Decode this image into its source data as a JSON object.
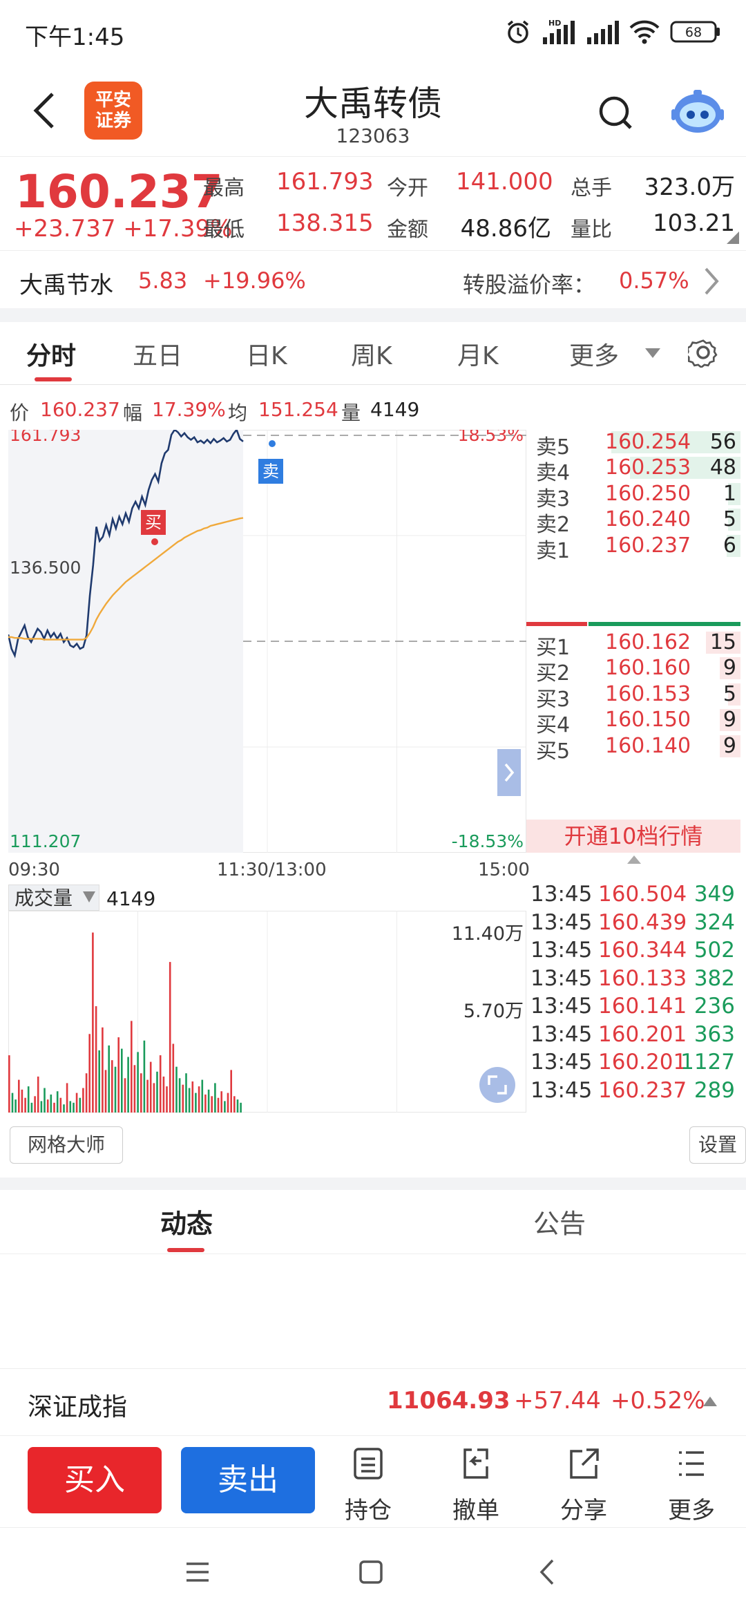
{
  "status": {
    "time": "下午1:45",
    "battery": "68",
    "network": "HD"
  },
  "header": {
    "title": "大禹转债",
    "code": "123063",
    "logo": "平安\n证券",
    "logo_line1": "平安",
    "logo_line2": "证券"
  },
  "quote": {
    "price": "160.237",
    "change": "+23.737",
    "change_pct": "+17.39%",
    "high_label": "最高",
    "high": "161.793",
    "low_label": "最低",
    "low": "138.315",
    "open_label": "今开",
    "open": "141.000",
    "amount_label": "金额",
    "amount": "48.86亿",
    "volume_label": "总手",
    "volume": "323.0万",
    "ratio_label": "量比",
    "ratio": "103.21"
  },
  "underlying": {
    "name": "大禹节水",
    "price": "5.83",
    "change_pct": "+19.96%",
    "premium_label": "转股溢价率：",
    "premium": "0.57%"
  },
  "tabs": [
    "分时",
    "五日",
    "日K",
    "周K",
    "月K",
    "更多"
  ],
  "active_tab": "分时",
  "infobar": {
    "price_label": "价",
    "price": "160.237",
    "amp_label": "幅",
    "amp": "17.39%",
    "avg_label": "均",
    "avg": "151.254",
    "vol_label": "量",
    "vol": "4149"
  },
  "chart_labels": {
    "top_left": "161.793",
    "top_right": "18.53%",
    "mid_left": "136.500",
    "bottom_left": "111.207",
    "bottom_right": "-18.53%",
    "buy_marker": "买",
    "sell_marker": "卖"
  },
  "orderbook": {
    "asks": [
      {
        "label": "卖5",
        "price": "160.254",
        "vol": "56"
      },
      {
        "label": "卖4",
        "price": "160.253",
        "vol": "48"
      },
      {
        "label": "卖3",
        "price": "160.250",
        "vol": "1"
      },
      {
        "label": "卖2",
        "price": "160.240",
        "vol": "5"
      },
      {
        "label": "卖1",
        "price": "160.237",
        "vol": "6"
      }
    ],
    "bids": [
      {
        "label": "买1",
        "price": "160.162",
        "vol": "15"
      },
      {
        "label": "买2",
        "price": "160.160",
        "vol": "9"
      },
      {
        "label": "买3",
        "price": "160.153",
        "vol": "5"
      },
      {
        "label": "买4",
        "price": "160.150",
        "vol": "9"
      },
      {
        "label": "买5",
        "price": "160.140",
        "vol": "9"
      }
    ],
    "upgrade": "开通10档行情"
  },
  "time_axis": [
    "09:30",
    "11:30/13:00",
    "15:00"
  ],
  "volume_panel": {
    "selector": "成交量",
    "value": "4149",
    "max_label": "11.40万",
    "mid_label": "5.70万"
  },
  "ticks": [
    {
      "time": "13:45",
      "price": "160.504",
      "vol": "349"
    },
    {
      "time": "13:45",
      "price": "160.439",
      "vol": "324"
    },
    {
      "time": "13:45",
      "price": "160.344",
      "vol": "502"
    },
    {
      "time": "13:45",
      "price": "160.133",
      "vol": "382"
    },
    {
      "time": "13:45",
      "price": "160.141",
      "vol": "236"
    },
    {
      "time": "13:45",
      "price": "160.201",
      "vol": "363"
    },
    {
      "time": "13:45",
      "price": "160.201",
      "vol": "1127"
    },
    {
      "time": "13:45",
      "price": "160.237",
      "vol": "289"
    }
  ],
  "buttons": {
    "grid": "网格大师",
    "settings": "设置"
  },
  "news_tabs": [
    "动态",
    "公告"
  ],
  "index": {
    "name": "深证成指",
    "value": "11064.93",
    "change": "+57.44",
    "change_pct": "+0.52%"
  },
  "toolbar": {
    "buy": "买入",
    "sell": "卖出",
    "position": "持仓",
    "cancel": "撤单",
    "share": "分享",
    "more": "更多"
  },
  "colors": {
    "up": "#e0393e",
    "down": "#1a9b5b",
    "sell_button": "#1e6fe0",
    "buy_button": "#e8262b",
    "avg_line": "#f0a93b",
    "price_line": "#1f3a6e"
  },
  "chart_data": {
    "type": "line",
    "title": "",
    "xlabel": "",
    "ylabel": "",
    "ylim": [
      111.207,
      161.793
    ],
    "reference": 136.5,
    "x_ticks": [
      "09:30",
      "11:30/13:00",
      "15:00"
    ],
    "series": [
      {
        "name": "价",
        "values": [
          137.3,
          135.6,
          134.8,
          136.8,
          137.6,
          138.4,
          137.0,
          136.4,
          137.2,
          138.0,
          137.6,
          136.8,
          137.8,
          137.0,
          137.5,
          136.8,
          137.4,
          136.4,
          136.9,
          136.0,
          135.8,
          136.2,
          135.6,
          135.8,
          137.2,
          142.0,
          145.6,
          150.2,
          148.5,
          149.0,
          150.4,
          149.2,
          151.1,
          150.0,
          151.4,
          150.5,
          151.8,
          150.8,
          152.4,
          153.2,
          152.4,
          153.8,
          152.8,
          154.6,
          155.8,
          156.5,
          155.6,
          157.8,
          159.0,
          159.4,
          161.2,
          161.8,
          161.5,
          161.0,
          161.4,
          160.9,
          160.6,
          160.9,
          160.3,
          160.5,
          160.2,
          160.6,
          160.2,
          160.7,
          160.3,
          160.5,
          160.8,
          160.4,
          160.6,
          161.3,
          161.8,
          160.7,
          160.4
        ]
      },
      {
        "name": "均",
        "values": [
          137.0,
          137.0,
          136.9,
          136.9,
          136.9,
          136.8,
          136.8,
          136.8,
          136.8,
          136.8,
          136.8,
          136.7,
          136.7,
          136.7,
          136.7,
          136.7,
          136.7,
          136.7,
          136.7,
          136.7,
          136.7,
          136.7,
          136.7,
          136.7,
          136.9,
          137.5,
          138.2,
          139.1,
          139.8,
          140.4,
          141.0,
          141.5,
          142.0,
          142.4,
          142.8,
          143.2,
          143.6,
          143.9,
          144.2,
          144.5,
          144.8,
          145.1,
          145.4,
          145.7,
          146.0,
          146.3,
          146.6,
          146.9,
          147.2,
          147.5,
          147.8,
          148.1,
          148.4,
          148.6,
          148.9,
          149.1,
          149.3,
          149.5,
          149.7,
          149.8,
          150.0,
          150.1,
          150.3,
          150.4,
          150.5,
          150.6,
          150.7,
          150.8,
          150.9,
          151.0,
          151.1,
          151.2,
          151.254
        ]
      }
    ],
    "volume": [
      3.5,
      1.2,
      0.8,
      2.0,
      1.4,
      0.9,
      1.6,
      0.6,
      1.0,
      2.2,
      0.7,
      1.5,
      0.8,
      1.1,
      0.6,
      1.3,
      0.9,
      0.5,
      1.8,
      0.7,
      0.6,
      1.2,
      0.9,
      1.5,
      2.4,
      4.8,
      11.0,
      6.5,
      3.8,
      5.2,
      2.6,
      4.1,
      3.2,
      2.8,
      4.6,
      3.9,
      2.1,
      3.4,
      5.6,
      2.9,
      3.7,
      2.4,
      4.4,
      2.0,
      3.1,
      1.8,
      2.5,
      3.5,
      2.2,
      1.6,
      9.2,
      4.2,
      2.8,
      2.1,
      1.7,
      2.4,
      1.5,
      1.9,
      1.2,
      1.6,
      2.0,
      1.1,
      1.4,
      1.0,
      1.8,
      0.9,
      1.3,
      0.7,
      1.2,
      2.6,
      1.0,
      0.8,
      0.6
    ],
    "volume_ylim": [
      0,
      11.4
    ]
  }
}
